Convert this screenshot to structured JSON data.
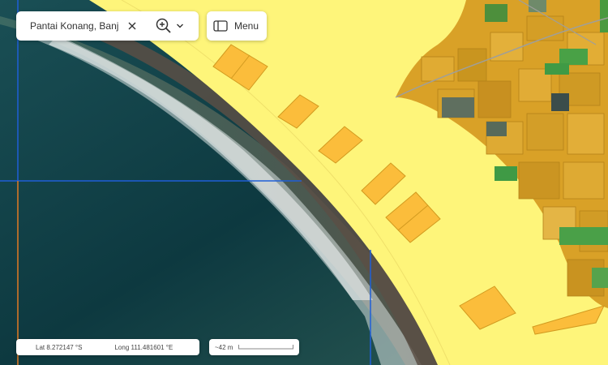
{
  "search": {
    "value": "Pantai Konang, Banj"
  },
  "menu": {
    "label": "Menu"
  },
  "coordinates": {
    "lat": "Lat 8.272147 °S",
    "long": "Long 111.481601 °E"
  },
  "scale": {
    "label": "~42 m"
  },
  "icons": {
    "clear": "close-icon",
    "zoom": "zoom-in-icon",
    "dropdown": "chevron-down-icon",
    "menu": "sidebar-panel-icon"
  },
  "colors": {
    "sea_deep": "#0e3c43",
    "sea_shallow": "#3d6b62",
    "surf": "#dfe6e4",
    "beach_sand": "#fef57a",
    "parcel_fill": "#fbbd3b",
    "parcel_stroke": "#d29a1f",
    "farmland": "#d9a127",
    "vegetation": "#4a9a3f",
    "grid_line_blue": "#1f5fd8",
    "grid_line_orange": "#e27a24"
  }
}
